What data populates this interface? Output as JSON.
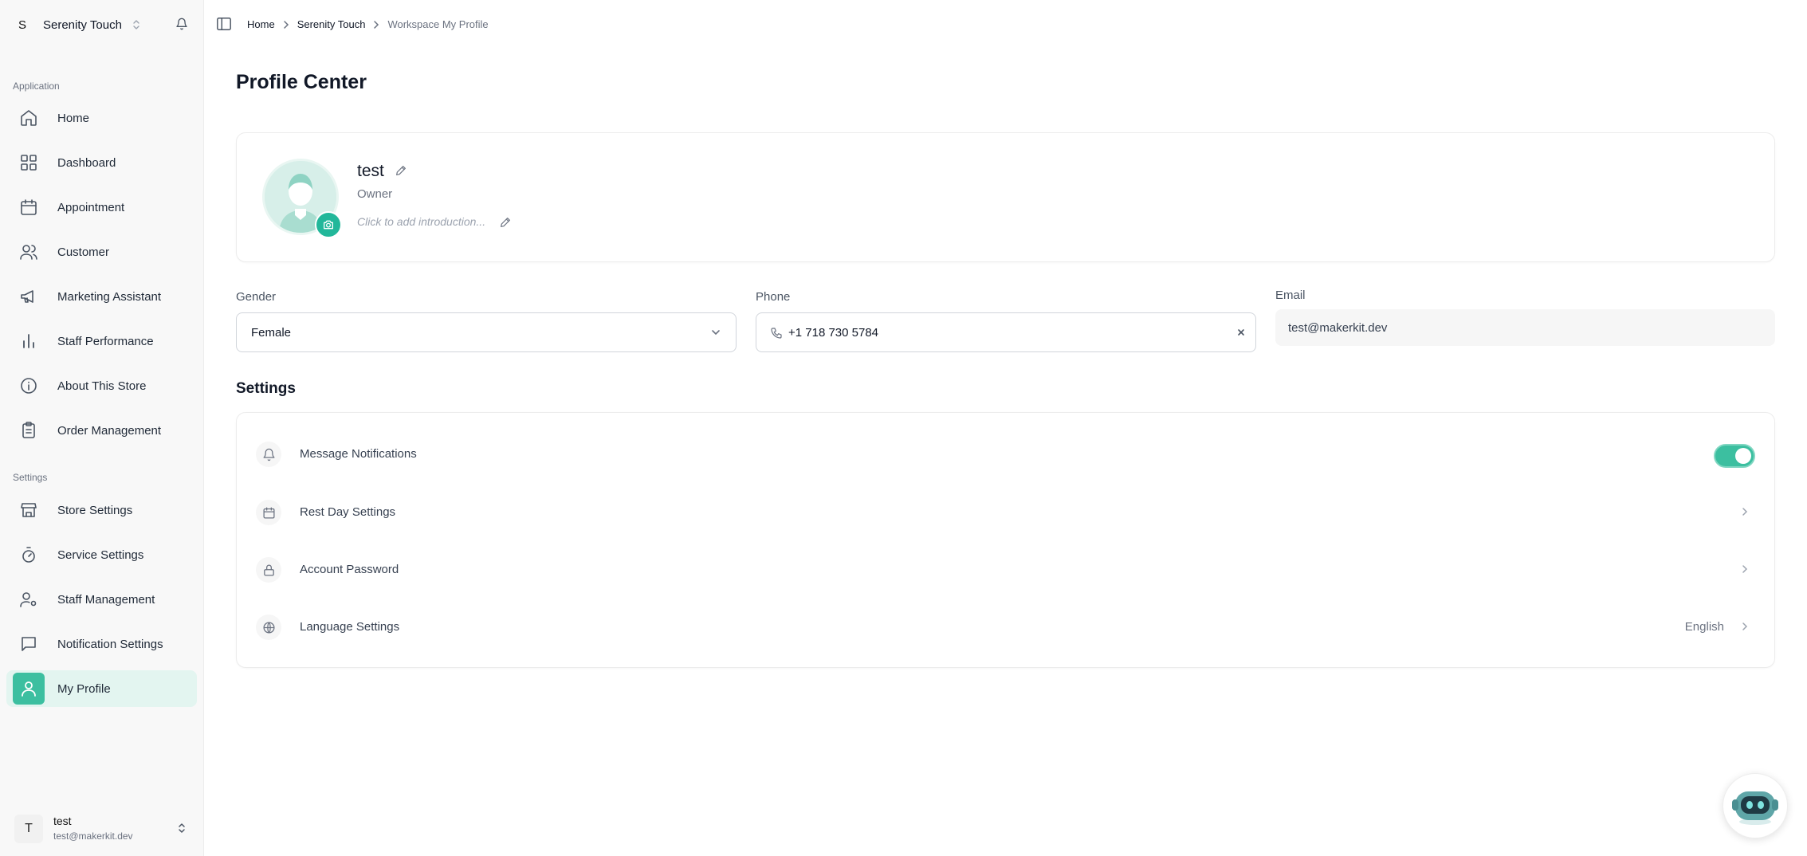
{
  "workspace": {
    "initial": "S",
    "name": "Serenity Touch"
  },
  "sidebar": {
    "sections": [
      {
        "label": "Application",
        "items": [
          {
            "label": "Home",
            "icon": "home-icon"
          },
          {
            "label": "Dashboard",
            "icon": "grid-icon"
          },
          {
            "label": "Appointment",
            "icon": "calendar-icon"
          },
          {
            "label": "Customer",
            "icon": "users-icon"
          },
          {
            "label": "Marketing Assistant",
            "icon": "megaphone-icon"
          },
          {
            "label": "Staff Performance",
            "icon": "bar-chart-icon"
          },
          {
            "label": "About This Store",
            "icon": "info-icon"
          },
          {
            "label": "Order Management",
            "icon": "clipboard-icon"
          }
        ]
      },
      {
        "label": "Settings",
        "items": [
          {
            "label": "Store Settings",
            "icon": "store-icon"
          },
          {
            "label": "Service Settings",
            "icon": "timer-icon"
          },
          {
            "label": "Staff Management",
            "icon": "user-cog-icon"
          },
          {
            "label": "Notification Settings",
            "icon": "message-icon"
          },
          {
            "label": "My Profile",
            "icon": "user-icon",
            "active": true
          }
        ]
      }
    ]
  },
  "user": {
    "initial": "T",
    "name": "test",
    "email": "test@makerkit.dev"
  },
  "breadcrumb": [
    "Home",
    "Serenity Touch",
    "Workspace My Profile"
  ],
  "page": {
    "title": "Profile Center"
  },
  "profile": {
    "name": "test",
    "role": "Owner",
    "intro_placeholder": "Click to add introduction..."
  },
  "fields": {
    "gender": {
      "label": "Gender",
      "value": "Female"
    },
    "phone": {
      "label": "Phone",
      "value": "+1 718 730 5784"
    },
    "email": {
      "label": "Email",
      "value": "test@makerkit.dev"
    }
  },
  "settings": {
    "heading": "Settings",
    "rows": [
      {
        "label": "Message Notifications",
        "icon": "bell-icon",
        "toggle": true
      },
      {
        "label": "Rest Day Settings",
        "icon": "calendar-icon"
      },
      {
        "label": "Account Password",
        "icon": "lock-icon"
      },
      {
        "label": "Language Settings",
        "icon": "globe-icon",
        "value": "English"
      }
    ]
  },
  "colors": {
    "accent": "#3cbfa0",
    "active_bg": "#e3f5f0",
    "sidebar_bg": "#f8f8f8"
  }
}
